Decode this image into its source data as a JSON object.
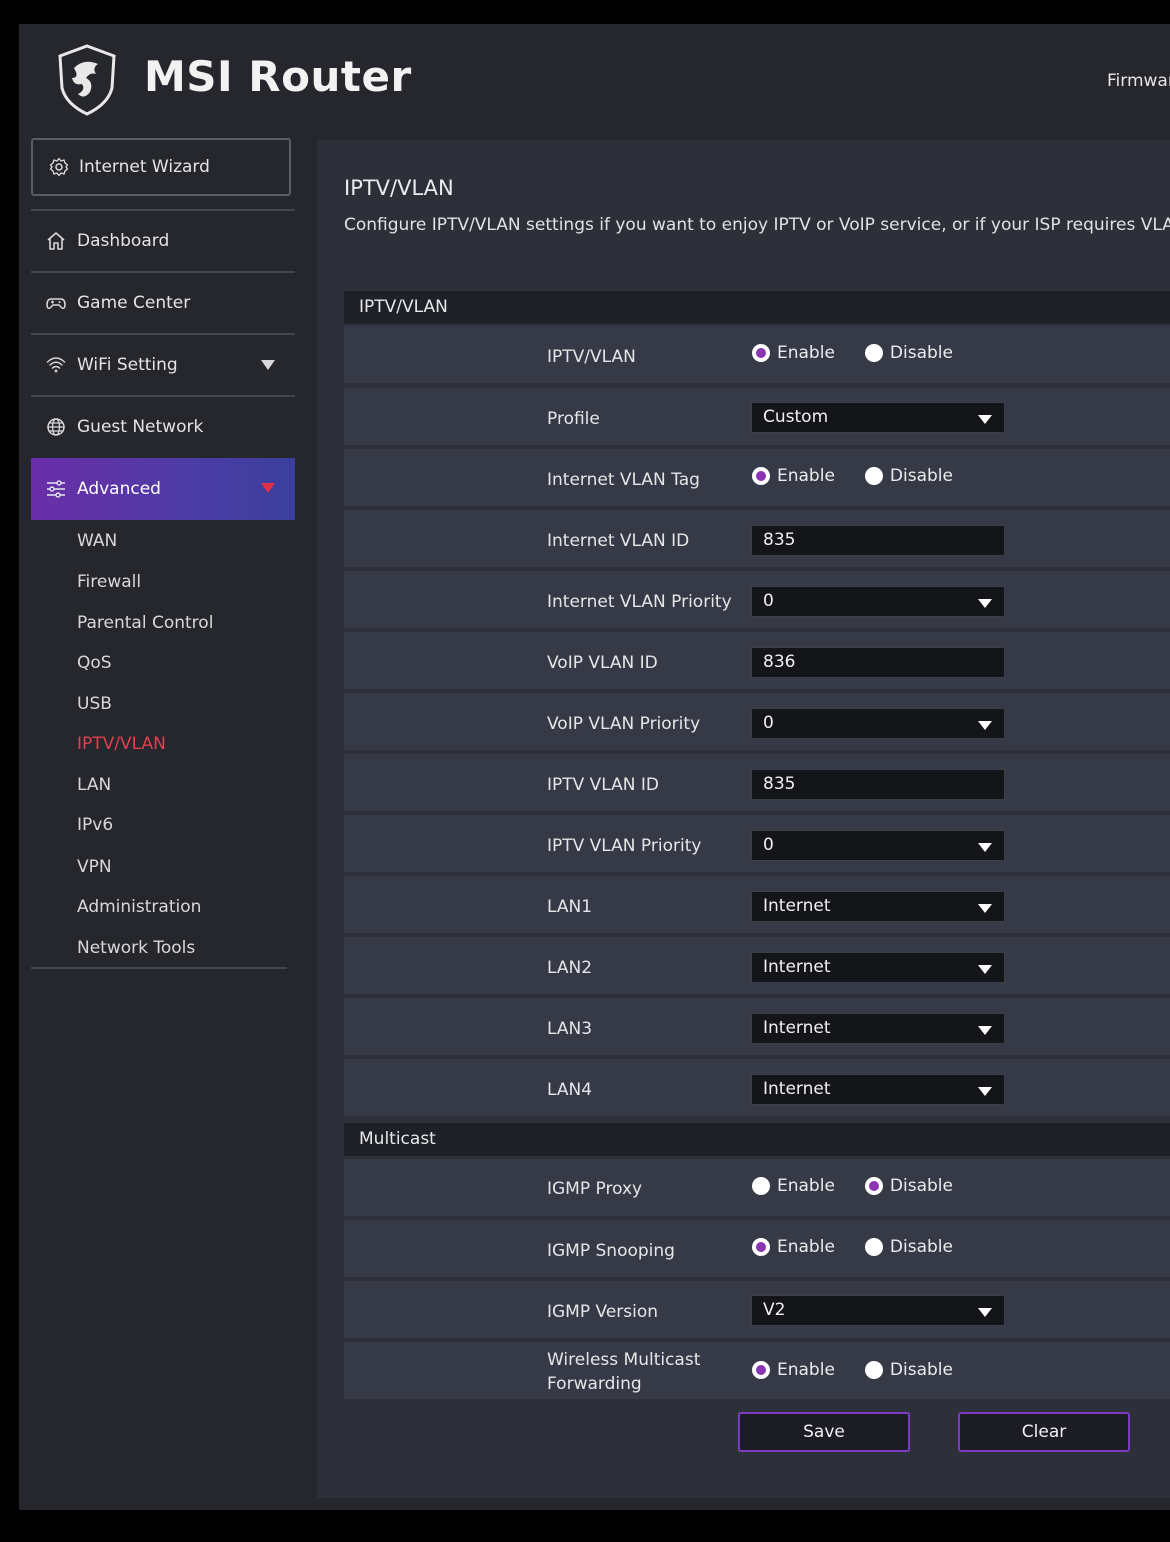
{
  "header": {
    "brand": "MSI Router",
    "firmware_label": "Firmwar"
  },
  "sidebar": {
    "wizard_label": "Internet Wizard",
    "items": [
      {
        "label": "Dashboard",
        "icon": "home-icon"
      },
      {
        "label": "Game Center",
        "icon": "gamepad-icon"
      },
      {
        "label": "WiFi Setting",
        "icon": "wifi-icon"
      },
      {
        "label": "Guest Network",
        "icon": "globe-icon"
      },
      {
        "label": "Advanced",
        "icon": "sliders-icon"
      }
    ],
    "sub_items": [
      "WAN",
      "Firewall",
      "Parental Control",
      "QoS",
      "USB",
      "IPTV/VLAN",
      "LAN",
      "IPv6",
      "VPN",
      "Administration",
      "Network Tools"
    ],
    "current_sub_item": "IPTV/VLAN",
    "accent_color": "#e04050"
  },
  "main": {
    "title": "IPTV/VLAN",
    "description": "Configure IPTV/VLAN settings if you want to enjoy IPTV or VoIP service, or if your ISP requires VLAN",
    "sections": {
      "iptv": "IPTV/VLAN",
      "multicast": "Multicast"
    },
    "radio_labels": {
      "enable": "Enable",
      "disable": "Disable"
    },
    "rows": [
      {
        "label": "IPTV/VLAN",
        "type": "radio",
        "value": "Enable"
      },
      {
        "label": "Profile",
        "type": "select",
        "value": "Custom"
      },
      {
        "label": "Internet VLAN Tag",
        "type": "radio",
        "value": "Enable"
      },
      {
        "label": "Internet VLAN ID",
        "type": "input",
        "value": "835"
      },
      {
        "label": "Internet VLAN Priority",
        "type": "select",
        "value": "0"
      },
      {
        "label": "VoIP VLAN ID",
        "type": "input",
        "value": "836"
      },
      {
        "label": "VoIP VLAN Priority",
        "type": "select",
        "value": "0"
      },
      {
        "label": "IPTV VLAN ID",
        "type": "input",
        "value": "835"
      },
      {
        "label": "IPTV VLAN Priority",
        "type": "select",
        "value": "0"
      },
      {
        "label": "LAN1",
        "type": "select",
        "value": "Internet"
      },
      {
        "label": "LAN2",
        "type": "select",
        "value": "Internet"
      },
      {
        "label": "LAN3",
        "type": "select",
        "value": "Internet"
      },
      {
        "label": "LAN4",
        "type": "select",
        "value": "Internet"
      }
    ],
    "multicast_rows": [
      {
        "label": "IGMP Proxy",
        "type": "radio",
        "value": "Disable"
      },
      {
        "label": "IGMP Snooping",
        "type": "radio",
        "value": "Enable"
      },
      {
        "label": "IGMP Version",
        "type": "select",
        "value": "V2"
      },
      {
        "label": "Wireless Multicast Forwarding",
        "type": "radio",
        "value": "Enable"
      }
    ],
    "buttons": {
      "save": "Save",
      "clear": "Clear"
    },
    "radio_selected_color": "#8b35b4"
  }
}
